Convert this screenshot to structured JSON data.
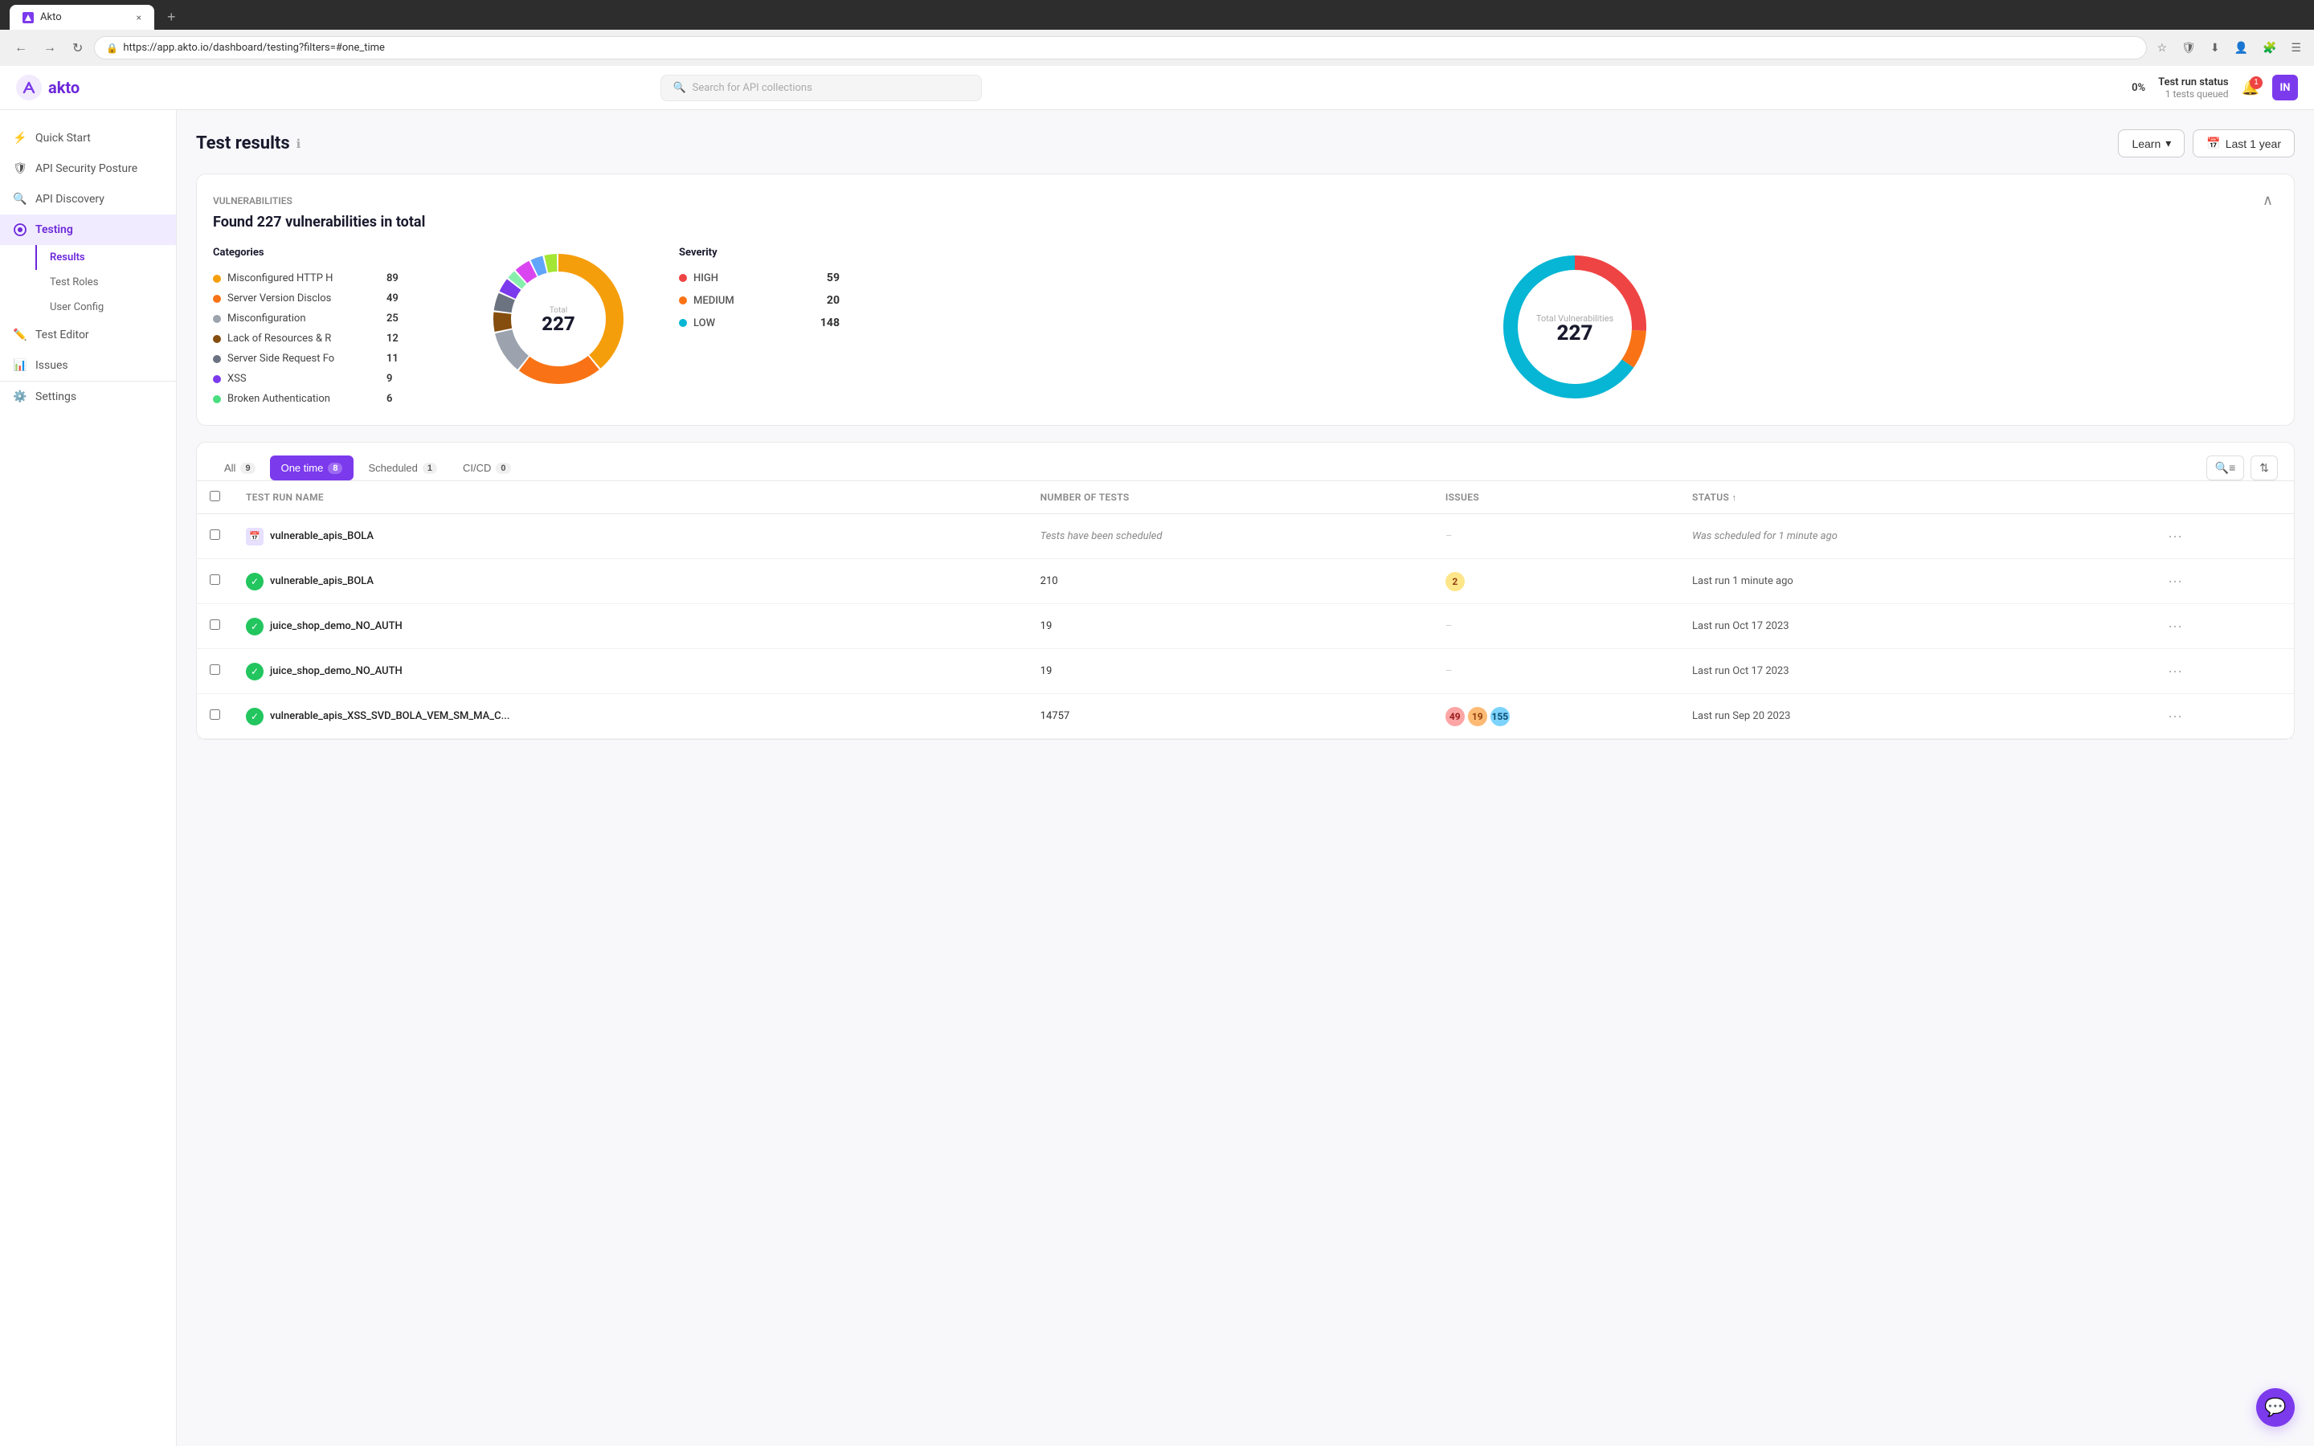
{
  "browser": {
    "tab_title": "Akto",
    "tab_close": "×",
    "tab_new": "+",
    "url": "https://app.akto.io/dashboard/testing?filters=#one_time",
    "nav_back": "←",
    "nav_forward": "→",
    "nav_refresh": "↻"
  },
  "header": {
    "logo_text": "akto",
    "search_placeholder": "Search for API collections",
    "progress_pct": "0%",
    "test_run_status_label": "Test run status",
    "tests_queued": "1 tests queued",
    "notif_count": "1",
    "avatar_text": "IN"
  },
  "sidebar": {
    "items": [
      {
        "id": "quick-start",
        "label": "Quick Start",
        "icon": "lightning"
      },
      {
        "id": "api-security-posture",
        "label": "API Security Posture",
        "icon": "shield"
      },
      {
        "id": "api-discovery",
        "label": "API Discovery",
        "icon": "search-circle"
      },
      {
        "id": "testing",
        "label": "Testing",
        "icon": "bug",
        "active": true,
        "sub": [
          {
            "id": "results",
            "label": "Results",
            "active": true
          },
          {
            "id": "test-roles",
            "label": "Test Roles"
          },
          {
            "id": "user-config",
            "label": "User Config"
          }
        ]
      },
      {
        "id": "test-editor",
        "label": "Test Editor",
        "icon": "edit"
      },
      {
        "id": "issues",
        "label": "Issues",
        "icon": "chart"
      }
    ],
    "settings_label": "Settings"
  },
  "page": {
    "title": "Test results",
    "learn_btn": "Learn",
    "date_btn": "Last 1 year"
  },
  "vulnerabilities": {
    "section_label": "Vulnerabilities",
    "summary": "Found 227 vulnerabilities in total",
    "categories_title": "Categories",
    "categories": [
      {
        "name": "Misconfigured HTTP H",
        "count": 89,
        "color": "#f59e0b"
      },
      {
        "name": "Server Version Disclos",
        "count": 49,
        "color": "#f97316"
      },
      {
        "name": "Misconfiguration",
        "count": 25,
        "color": "#9ca3af"
      },
      {
        "name": "Lack of Resources & R",
        "count": 12,
        "color": "#854d0e"
      },
      {
        "name": "Server Side Request Fo",
        "count": 11,
        "color": "#6b7280"
      },
      {
        "name": "XSS",
        "count": 9,
        "color": "#7c3aed"
      },
      {
        "name": "Broken Authentication",
        "count": 6,
        "color": "#4ade80"
      }
    ],
    "severity": {
      "title": "Severity",
      "items": [
        {
          "label": "HIGH",
          "count": 59,
          "color": "#ef4444"
        },
        {
          "label": "MEDIUM",
          "count": 20,
          "color": "#f97316"
        },
        {
          "label": "LOW",
          "count": 148,
          "color": "#06b6d4"
        }
      ]
    },
    "total": {
      "label": "Total Vulnerabilities",
      "value": 227
    },
    "donut": {
      "segments": [
        {
          "value": 89,
          "color": "#f59e0b"
        },
        {
          "value": 49,
          "color": "#f97316"
        },
        {
          "value": 25,
          "color": "#9ca3af"
        },
        {
          "value": 12,
          "color": "#854d0e"
        },
        {
          "value": 11,
          "color": "#6b7280"
        },
        {
          "value": 9,
          "color": "#7c3aed"
        },
        {
          "value": 6,
          "color": "#86efac"
        },
        {
          "value": 10,
          "color": "#d946ef"
        },
        {
          "value": 8,
          "color": "#60a5fa"
        },
        {
          "value": 8,
          "color": "#a3e635"
        }
      ],
      "total": 227
    }
  },
  "table": {
    "tabs": [
      {
        "id": "all",
        "label": "All",
        "count": 9
      },
      {
        "id": "one-time",
        "label": "One time",
        "count": 8,
        "active": true
      },
      {
        "id": "scheduled",
        "label": "Scheduled",
        "count": 1
      },
      {
        "id": "cicd",
        "label": "CI/CD",
        "count": 0
      }
    ],
    "columns": [
      {
        "id": "check",
        "label": ""
      },
      {
        "id": "name",
        "label": "Test run name"
      },
      {
        "id": "tests",
        "label": "Number of tests"
      },
      {
        "id": "issues",
        "label": "Issues"
      },
      {
        "id": "status",
        "label": "Status"
      },
      {
        "id": "actions",
        "label": ""
      }
    ],
    "rows": [
      {
        "id": "row1",
        "icon_type": "calendar",
        "name": "vulnerable_apis_BOLA",
        "tests": "Tests have been scheduled",
        "issues": "-",
        "issues_type": "dash",
        "status": "Was scheduled for 1 minute ago",
        "status_type": "scheduled"
      },
      {
        "id": "row2",
        "icon_type": "check",
        "name": "vulnerable_apis_BOLA",
        "tests": "210",
        "issues": "2",
        "issues_type": "orange",
        "status": "Last run 1 minute ago",
        "status_type": "normal"
      },
      {
        "id": "row3",
        "icon_type": "check",
        "name": "juice_shop_demo_NO_AUTH",
        "tests": "19",
        "issues": "-",
        "issues_type": "dash",
        "status": "Last run Oct 17 2023",
        "status_type": "normal"
      },
      {
        "id": "row4",
        "icon_type": "check",
        "name": "juice_shop_demo_NO_AUTH",
        "tests": "19",
        "issues": "-",
        "issues_type": "dash",
        "status": "Last run Oct 17 2023",
        "status_type": "normal"
      },
      {
        "id": "row5",
        "icon_type": "check",
        "name": "vulnerable_apis_XSS_SVD_BOLA_VEM_SM_MA_C...",
        "tests": "14757",
        "issues_badges": [
          {
            "value": "49",
            "type": "red"
          },
          {
            "value": "19",
            "type": "orange"
          },
          {
            "value": "155",
            "type": "blue"
          }
        ],
        "status": "Last run Sep 20 2023",
        "status_type": "normal"
      }
    ],
    "more_label": "···"
  }
}
